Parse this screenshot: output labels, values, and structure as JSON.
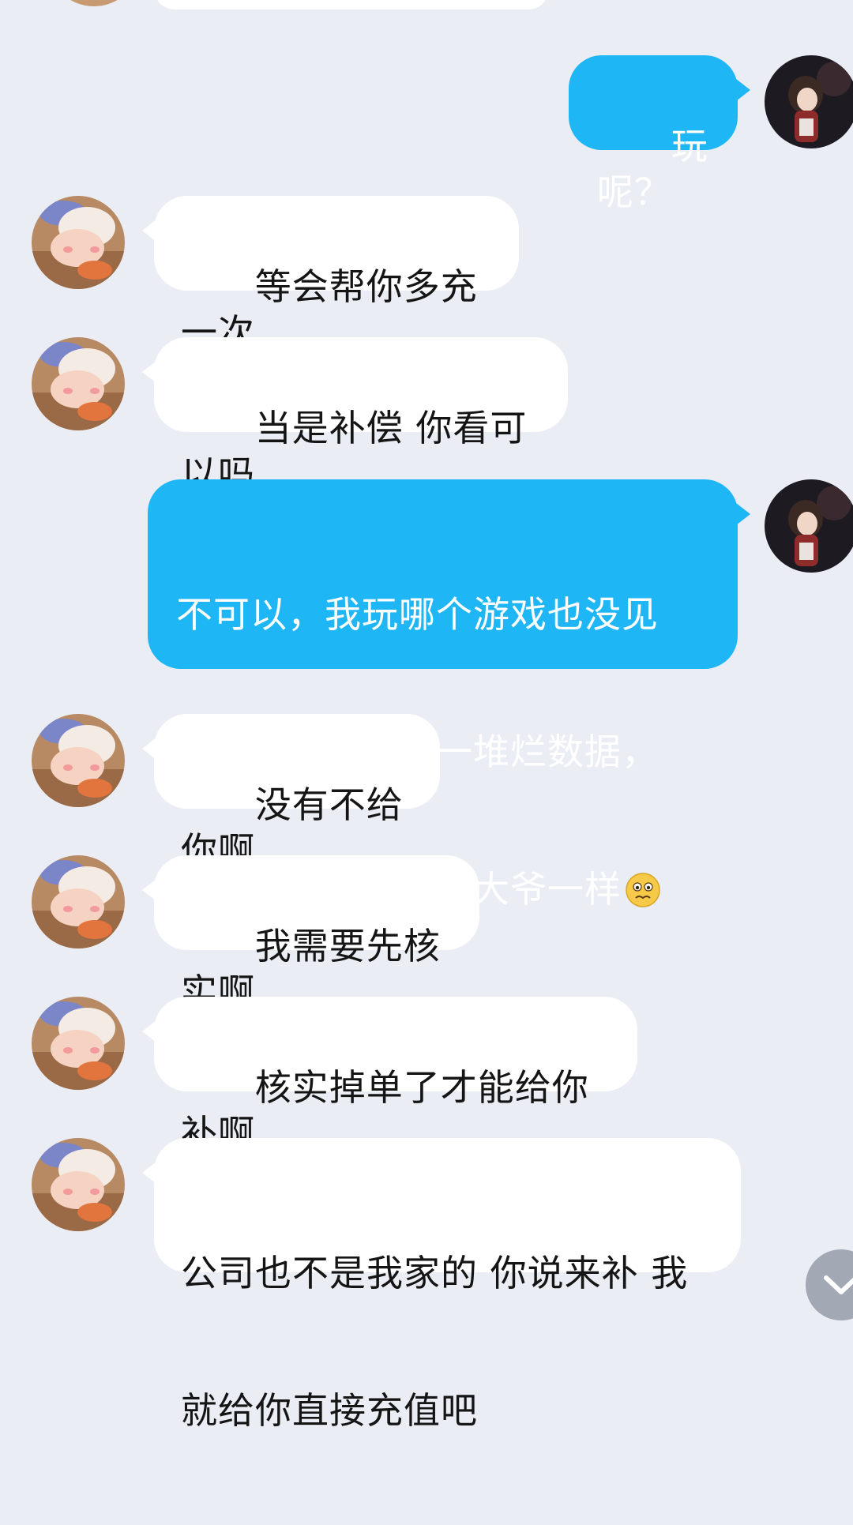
{
  "theme": {
    "background": "#eaedf4",
    "incoming_bubble": "#ffffff",
    "outgoing_bubble": "#1eb6f5",
    "scroll_button": "#a2a8b4"
  },
  "messages": [
    {
      "from": "me",
      "text": "玩呢？"
    },
    {
      "from": "other",
      "text": "等会帮你多充一次"
    },
    {
      "from": "other",
      "text": "当是补偿 你看可以吗"
    },
    {
      "from": "me",
      "text_lines": [
        "不可以，我玩哪个游戏也没见",
        "你们这样的，就一堆烂数据，",
        "充值还不给，客服大爷一样"
      ],
      "emoji": "worried-face-emoji"
    },
    {
      "from": "other",
      "text": "没有不给你啊"
    },
    {
      "from": "other",
      "text": "我需要先核实啊"
    },
    {
      "from": "other",
      "text": "核实掉单了才能给你补啊"
    },
    {
      "from": "other",
      "text_lines": [
        "公司也不是我家的 你说来补 我",
        "就给你直接充值吧"
      ]
    }
  ],
  "controls": {
    "scroll_down_icon": "chevron-down-icon"
  }
}
